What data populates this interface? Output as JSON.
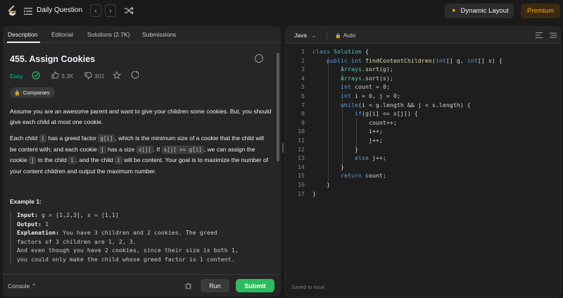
{
  "topbar": {
    "title": "Daily Question",
    "prev_glyph": "‹",
    "next_glyph": "›",
    "dynamic_layout": "Dynamic Layout",
    "premium": "Premium"
  },
  "tabs": [
    {
      "label": "Description"
    },
    {
      "label": "Editorial"
    },
    {
      "label": "Solutions (2.7K)"
    },
    {
      "label": "Submissions"
    }
  ],
  "problem": {
    "title": "455. Assign Cookies",
    "difficulty": "Easy",
    "likes": "3.3K",
    "dislikes": "302",
    "companies": "Companies",
    "more": "···",
    "p1": "Assume you are an awesome parent and want to give your children some cookies. But, you should give each child at most one cookie.",
    "p2a": "Each child ",
    "c_i": "i",
    "p2b": " has a greed factor ",
    "c_gi": "g[i]",
    "p2c": ", which is the minimum size of a cookie that the child will be content with; and each cookie ",
    "c_j": "j",
    "p2d": " has a size ",
    "c_sj": "s[j]",
    "p2e": ". If ",
    "c_cond": "s[j] >= g[i]",
    "p2f": ", we can assign the cookie ",
    "c_j2": "j",
    "p2g": " to the child ",
    "c_i2": "i",
    "p2h": ", and the child ",
    "c_i3": "i",
    "p2i": " will be content. Your goal is to maximize the number of your content children and output the maximum number.",
    "example_heading": "Example 1:",
    "ex_input_label": "Input:",
    "ex_input": " g = [1,2,3], s = [1,1]",
    "ex_output_label": "Output:",
    "ex_output": " 1",
    "ex_expl_label": "Explanation:",
    "ex_expl1": " You have 3 children and 2 cookies. The greed",
    "ex_expl2": "factors of 3 children are 1, 2, 3.",
    "ex_expl3": "And even though you have 2 cookies, since their size is both 1,",
    "ex_expl4": "you could only make the child whose greed factor is 1 content."
  },
  "bottom": {
    "console": "Console",
    "run": "Run",
    "submit": "Submit"
  },
  "editor": {
    "language": "Java",
    "mode": "Auto",
    "saved": "Saved to local",
    "line_numbers": [
      "1",
      "2",
      "3",
      "4",
      "5",
      "6",
      "7",
      "8",
      "9",
      "10",
      "11",
      "12",
      "13",
      "14",
      "15",
      "16",
      "17"
    ]
  },
  "colors": {
    "accent_green": "#2cbb5d",
    "easy": "#00b8a3",
    "premium": "#ffa116"
  }
}
